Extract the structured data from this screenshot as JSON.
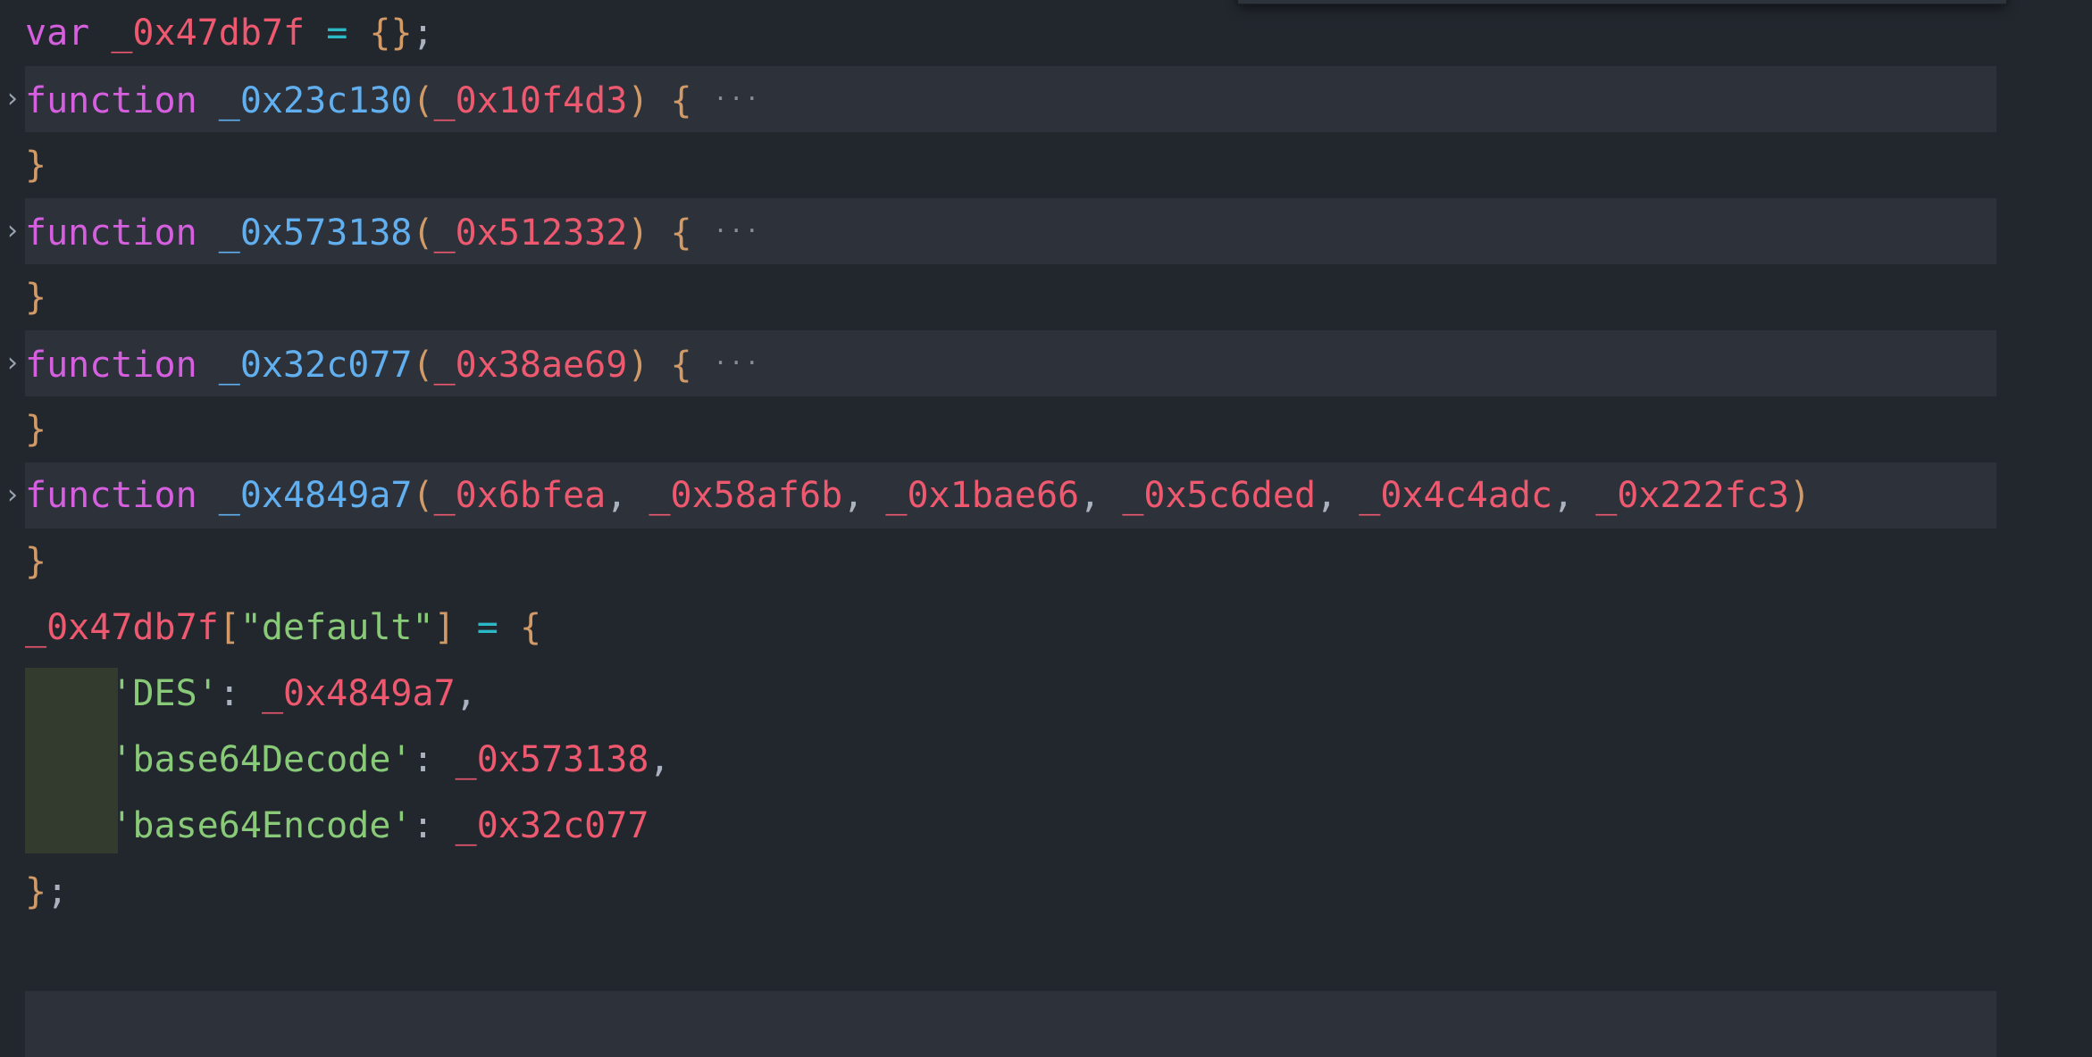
{
  "editor": {
    "language": "javascript",
    "theme": "One Dark Pro",
    "colors": {
      "background": "#22272e",
      "line_highlight": "#2c313a",
      "selection_block": "#333b2e",
      "keyword": "#d55fde",
      "identifier": "#ef596f",
      "function_name": "#61afef",
      "string": "#89ca78",
      "bracket": "#d19a66",
      "operator": "#2bbac5",
      "punctuation": "#abb2bf",
      "fold_marker": "#868e9b"
    },
    "fold_chevron": "›",
    "fold_ellipsis": "···"
  },
  "lines": [
    {
      "id": "line-var-decl",
      "folded": false,
      "highlighted": false,
      "tokens": [
        {
          "text": "var",
          "kind": "keyword"
        },
        {
          "text": " ",
          "kind": "plain"
        },
        {
          "text": "_0x47db7f",
          "kind": "identifier"
        },
        {
          "text": " ",
          "kind": "plain"
        },
        {
          "text": "=",
          "kind": "operator"
        },
        {
          "text": " ",
          "kind": "plain"
        },
        {
          "text": "{}",
          "kind": "bracket"
        },
        {
          "text": ";",
          "kind": "punctuation"
        }
      ]
    },
    {
      "id": "line-fn-0x23c130",
      "folded": true,
      "highlighted": true,
      "tokens": [
        {
          "text": "function",
          "kind": "keyword"
        },
        {
          "text": " ",
          "kind": "plain"
        },
        {
          "text": "_0x23c130",
          "kind": "function_name"
        },
        {
          "text": "(",
          "kind": "bracket"
        },
        {
          "text": "_0x10f4d3",
          "kind": "identifier"
        },
        {
          "text": ")",
          "kind": "bracket"
        },
        {
          "text": " ",
          "kind": "plain"
        },
        {
          "text": "{",
          "kind": "bracket"
        },
        {
          "text": " ",
          "kind": "plain"
        },
        {
          "text": "···",
          "kind": "fold"
        }
      ]
    },
    {
      "id": "line-close-1",
      "folded": false,
      "highlighted": false,
      "tokens": [
        {
          "text": "}",
          "kind": "bracket"
        }
      ]
    },
    {
      "id": "line-fn-0x573138",
      "folded": true,
      "highlighted": true,
      "tokens": [
        {
          "text": "function",
          "kind": "keyword"
        },
        {
          "text": " ",
          "kind": "plain"
        },
        {
          "text": "_0x573138",
          "kind": "function_name"
        },
        {
          "text": "(",
          "kind": "bracket"
        },
        {
          "text": "_0x512332",
          "kind": "identifier"
        },
        {
          "text": ")",
          "kind": "bracket"
        },
        {
          "text": " ",
          "kind": "plain"
        },
        {
          "text": "{",
          "kind": "bracket"
        },
        {
          "text": " ",
          "kind": "plain"
        },
        {
          "text": "···",
          "kind": "fold"
        }
      ]
    },
    {
      "id": "line-close-2",
      "folded": false,
      "highlighted": false,
      "tokens": [
        {
          "text": "}",
          "kind": "bracket"
        }
      ]
    },
    {
      "id": "line-fn-0x32c077",
      "folded": true,
      "highlighted": true,
      "tokens": [
        {
          "text": "function",
          "kind": "keyword"
        },
        {
          "text": " ",
          "kind": "plain"
        },
        {
          "text": "_0x32c077",
          "kind": "function_name"
        },
        {
          "text": "(",
          "kind": "bracket"
        },
        {
          "text": "_0x38ae69",
          "kind": "identifier"
        },
        {
          "text": ")",
          "kind": "bracket"
        },
        {
          "text": " ",
          "kind": "plain"
        },
        {
          "text": "{",
          "kind": "bracket"
        },
        {
          "text": " ",
          "kind": "plain"
        },
        {
          "text": "···",
          "kind": "fold"
        }
      ]
    },
    {
      "id": "line-close-3",
      "folded": false,
      "highlighted": false,
      "tokens": [
        {
          "text": "}",
          "kind": "bracket"
        }
      ]
    },
    {
      "id": "line-fn-0x4849a7",
      "folded": true,
      "highlighted": true,
      "tokens": [
        {
          "text": "function",
          "kind": "keyword"
        },
        {
          "text": " ",
          "kind": "plain"
        },
        {
          "text": "_0x4849a7",
          "kind": "function_name"
        },
        {
          "text": "(",
          "kind": "bracket"
        },
        {
          "text": "_0x6bfea",
          "kind": "identifier"
        },
        {
          "text": ",",
          "kind": "punctuation"
        },
        {
          "text": " ",
          "kind": "plain"
        },
        {
          "text": "_0x58af6b",
          "kind": "identifier"
        },
        {
          "text": ",",
          "kind": "punctuation"
        },
        {
          "text": " ",
          "kind": "plain"
        },
        {
          "text": "_0x1bae66",
          "kind": "identifier"
        },
        {
          "text": ",",
          "kind": "punctuation"
        },
        {
          "text": " ",
          "kind": "plain"
        },
        {
          "text": "_0x5c6ded",
          "kind": "identifier"
        },
        {
          "text": ",",
          "kind": "punctuation"
        },
        {
          "text": " ",
          "kind": "plain"
        },
        {
          "text": "_0x4c4adc",
          "kind": "identifier"
        },
        {
          "text": ",",
          "kind": "punctuation"
        },
        {
          "text": " ",
          "kind": "plain"
        },
        {
          "text": "_0x222fc3",
          "kind": "identifier"
        },
        {
          "text": ")",
          "kind": "bracket"
        }
      ]
    },
    {
      "id": "line-close-4",
      "folded": false,
      "highlighted": false,
      "tokens": [
        {
          "text": "}",
          "kind": "bracket"
        }
      ]
    },
    {
      "id": "line-default-assign",
      "folded": false,
      "highlighted": false,
      "tokens": [
        {
          "text": "_0x47db7f",
          "kind": "identifier"
        },
        {
          "text": "[",
          "kind": "bracket"
        },
        {
          "text": "\"default\"",
          "kind": "string"
        },
        {
          "text": "]",
          "kind": "bracket"
        },
        {
          "text": " ",
          "kind": "plain"
        },
        {
          "text": "=",
          "kind": "operator"
        },
        {
          "text": " ",
          "kind": "plain"
        },
        {
          "text": "{",
          "kind": "bracket"
        }
      ]
    },
    {
      "id": "line-prop-des",
      "folded": false,
      "highlighted": false,
      "indent": 4,
      "tokens": [
        {
          "text": "    ",
          "kind": "plain"
        },
        {
          "text": "'DES'",
          "kind": "string"
        },
        {
          "text": ":",
          "kind": "punctuation"
        },
        {
          "text": " ",
          "kind": "plain"
        },
        {
          "text": "_0x4849a7",
          "kind": "identifier"
        },
        {
          "text": ",",
          "kind": "punctuation"
        }
      ]
    },
    {
      "id": "line-prop-base64decode",
      "folded": false,
      "highlighted": false,
      "indent": 4,
      "tokens": [
        {
          "text": "    ",
          "kind": "plain"
        },
        {
          "text": "'base64Decode'",
          "kind": "string"
        },
        {
          "text": ":",
          "kind": "punctuation"
        },
        {
          "text": " ",
          "kind": "plain"
        },
        {
          "text": "_0x573138",
          "kind": "identifier"
        },
        {
          "text": ",",
          "kind": "punctuation"
        }
      ]
    },
    {
      "id": "line-prop-base64encode",
      "folded": false,
      "highlighted": false,
      "indent": 4,
      "tokens": [
        {
          "text": "    ",
          "kind": "plain"
        },
        {
          "text": "'base64Encode'",
          "kind": "string"
        },
        {
          "text": ":",
          "kind": "punctuation"
        },
        {
          "text": " ",
          "kind": "plain"
        },
        {
          "text": "_0x32c077",
          "kind": "identifier"
        }
      ]
    },
    {
      "id": "line-close-obj",
      "folded": false,
      "highlighted": false,
      "tokens": [
        {
          "text": "}",
          "kind": "bracket"
        },
        {
          "text": ";",
          "kind": "punctuation"
        }
      ]
    },
    {
      "id": "line-blank",
      "folded": false,
      "highlighted": false,
      "tokens": []
    },
    {
      "id": "line-next-folded",
      "folded": false,
      "highlighted": true,
      "tokens": []
    }
  ]
}
